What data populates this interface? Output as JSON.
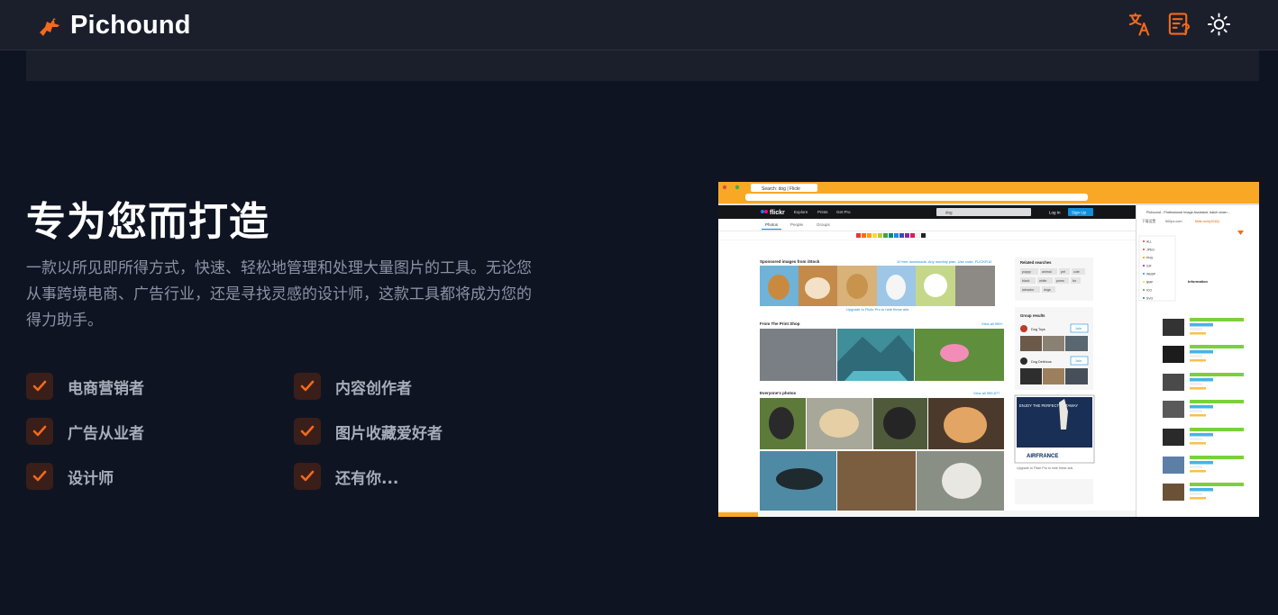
{
  "header": {
    "brand": "Pichound",
    "icons": [
      "dog-logo-icon",
      "translate-icon",
      "notes-help-icon",
      "sun-icon"
    ],
    "accent": "#f26a1b"
  },
  "hero": {
    "title": "专为您而打造",
    "description": "一款以所见即所得方式，快速、轻松地管理和处理大量图片的工具。无论您从事跨境电商、广告行业，还是寻找灵感的设计师，这款工具都将成为您的得力助手。"
  },
  "features": [
    {
      "label": "电商营销者"
    },
    {
      "label": "内容创作者"
    },
    {
      "label": "广告从业者"
    },
    {
      "label": "图片收藏爱好者"
    },
    {
      "label": "设计师"
    },
    {
      "label": "还有你..."
    }
  ],
  "screenshot": {
    "browser_tab": "Search: dog | Flickr",
    "site_logo": "flickr",
    "nav": [
      "Explore",
      "Prints",
      "Get Pro"
    ],
    "search_value": "dog",
    "login": "Log In",
    "signup": "Sign Up",
    "subtabs": [
      "Photos",
      "People",
      "Groups"
    ],
    "sponsored": "Sponsored images from iStock",
    "promo": "10 free downloads. Any monthly plan. Use code: FLICKR10",
    "upgrade": "Upgrade to Flickr Pro to hide these ads",
    "print_shop": "From The Print Shop",
    "view_all": "View all 999+",
    "everyone": "Everyone's photos",
    "view_all2": "View all 999,877",
    "related": "Related searches",
    "tags": [
      "puppy",
      "animal",
      "pet",
      "cute",
      "black",
      "white",
      "poms",
      "fur",
      "labrador",
      "dogs"
    ],
    "group_results": "Group results",
    "groups": [
      {
        "name": "Dog Toys",
        "join": "Join"
      },
      {
        "name": "Dog Delirious",
        "join": "Join"
      }
    ],
    "ad_headline": "ENJOY THE PERFECT GETAWAY",
    "ad_brand": "AIRFRANCE",
    "ad_caption": "Upgrade to Flickr Pro to hide these ads",
    "panel_title": "Pichound - Professional Image Assistant, batch down...",
    "panel_tabs": [
      "下载设置",
      "500px.com",
      "flickr.com(1015)"
    ],
    "formats": [
      "ALL",
      "JPEG",
      "PNG",
      "GIF",
      "WEBP",
      "BMP",
      "ICO",
      "SVG"
    ],
    "info_label": "Information"
  }
}
